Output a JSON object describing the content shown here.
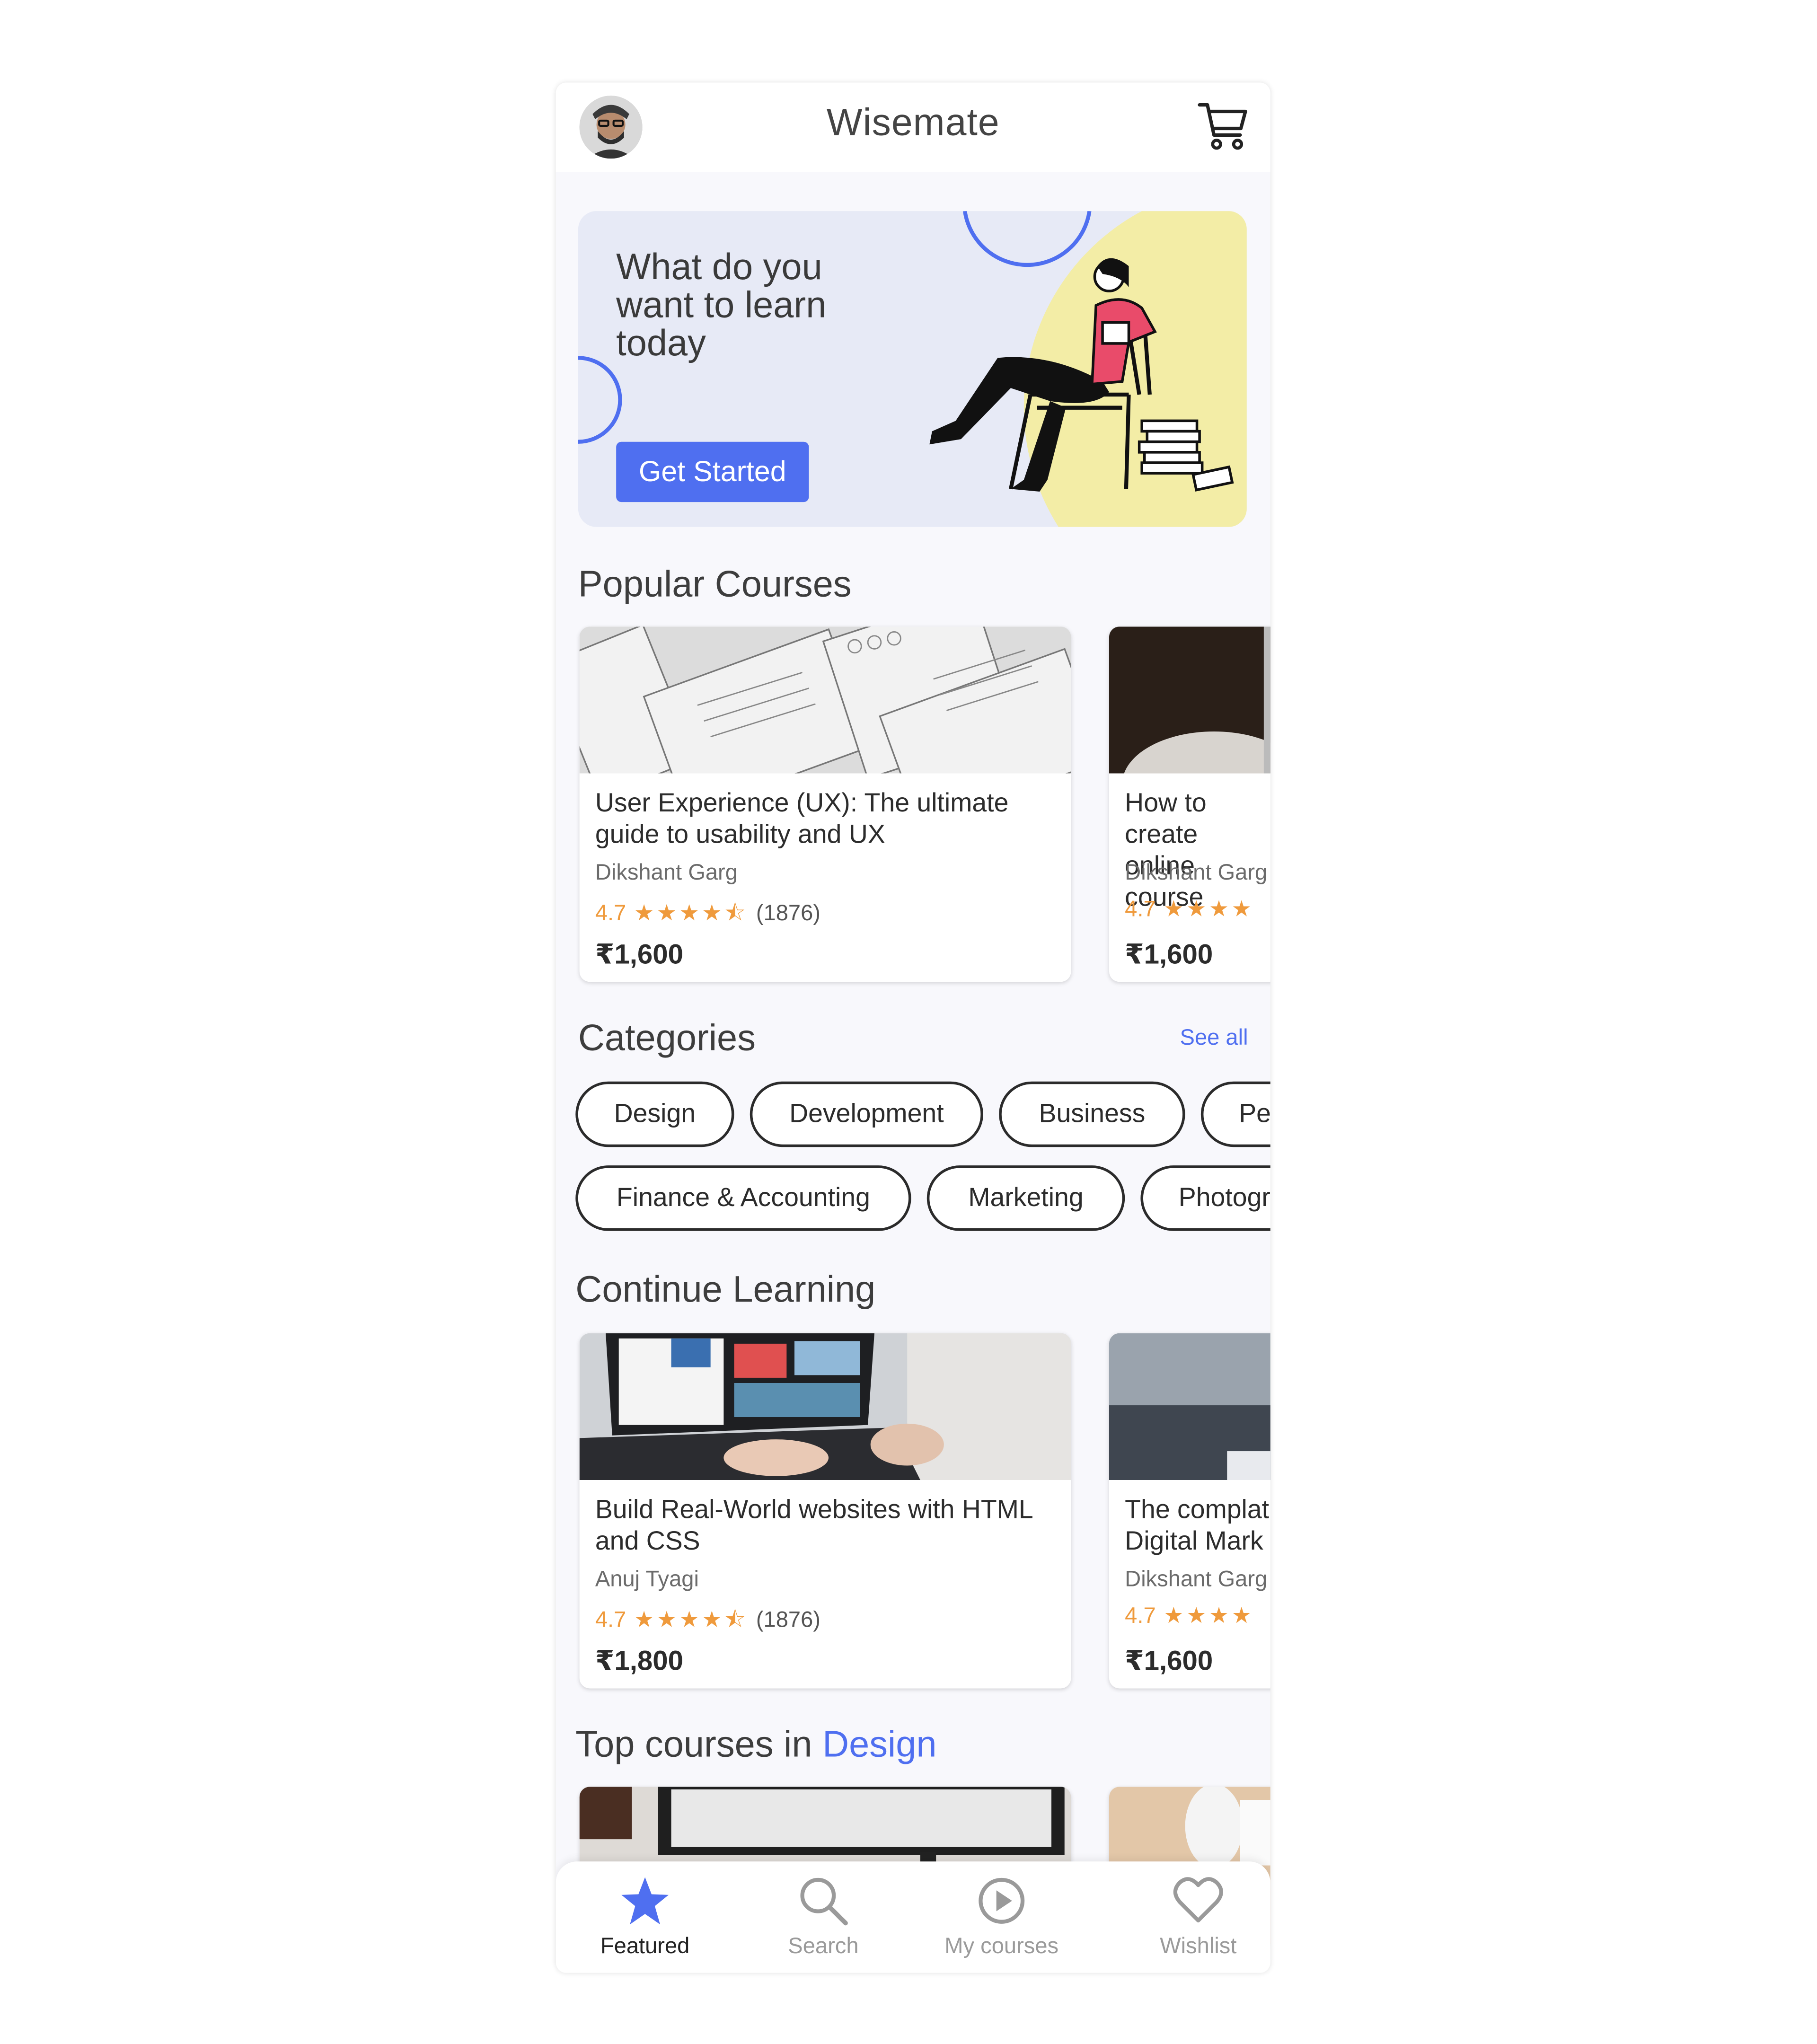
{
  "app": {
    "title": "Wisemate"
  },
  "hero": {
    "headline": "What do you want to learn today",
    "button_label": "Get Started"
  },
  "popular": {
    "title": "Popular Courses",
    "courses": [
      {
        "title": "User Experience (UX): The ultimate guide to usability and UX",
        "author": "Dikshant Garg",
        "rating": "4.7",
        "stars": "★★★★⯪",
        "count": "(1876)",
        "price": "₹1,600"
      },
      {
        "title": "How to create online course",
        "author": "Dikshant Garg",
        "rating": "4.7",
        "stars": "★★★★",
        "count": "",
        "price": "₹1,600"
      }
    ]
  },
  "categories": {
    "title": "Categories",
    "see_all": "See all",
    "row1": [
      "Design",
      "Development",
      "Business",
      "Pe"
    ],
    "row2": [
      "Finance & Accounting",
      "Marketing",
      "Photogr"
    ]
  },
  "continue": {
    "title": "Continue Learning",
    "courses": [
      {
        "title": "Build Real-World websites with HTML and CSS",
        "author": "Anuj Tyagi",
        "rating": "4.7",
        "stars": "★★★★⯪",
        "count": "(1876)",
        "price": "₹1,800"
      },
      {
        "title": "The complat Digital Mark",
        "author": "Dikshant Garg",
        "rating": "4.7",
        "stars": "★★★★",
        "count": "",
        "price": "₹1,600"
      }
    ]
  },
  "top_design": {
    "prefix": "Top courses in ",
    "category": "Design"
  },
  "nav": [
    {
      "label": "Featured",
      "icon": "star-icon",
      "active": true
    },
    {
      "label": "Search",
      "icon": "search-icon",
      "active": false
    },
    {
      "label": "My courses",
      "icon": "play-circle-icon",
      "active": false
    },
    {
      "label": "Wishlist",
      "icon": "heart-icon",
      "active": false
    }
  ],
  "colors": {
    "accent": "#4F6FF0",
    "rating": "#EF9A3C",
    "hero_bg": "#E7EAF6",
    "hero_blob": "#F3EDA6"
  }
}
